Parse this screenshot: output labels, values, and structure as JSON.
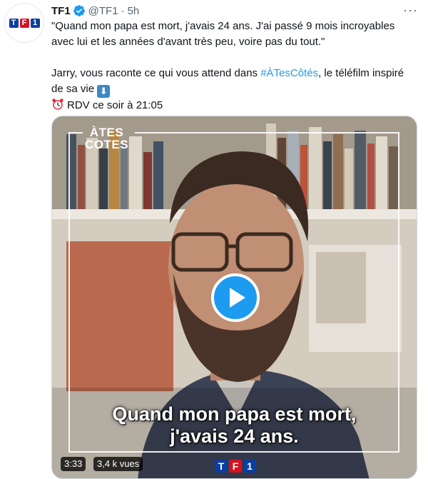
{
  "tweet": {
    "author_name": "TF1",
    "handle": "@TF1",
    "separator": "·",
    "time": "5h",
    "more_label": "···",
    "avatar_logo": [
      "T",
      "F",
      "1"
    ],
    "line1": "\"Quand mon papa est mort, j'avais 24 ans. J'ai passé 9 mois incroyables",
    "line2": "avec lui et les années d'avant très peu, voire pas du tout.\"",
    "line3_pre": "Jarry, vous raconte ce qui vous attend dans ",
    "hashtag": "#ÀTesCôtés",
    "line3_post": ", le téléfilm inspiré",
    "line4": "de sa vie ",
    "down_arrow": "⬇",
    "line5": "RDV ce soir à 21:05"
  },
  "media": {
    "show_logo_line1": "ÀTES",
    "show_logo_line2": "COTES",
    "subtitle_line1": "Quand mon papa est mort,",
    "subtitle_line2": "j'avais 24 ans.",
    "duration": "3:33",
    "views": "3,4 k vues",
    "watermark": [
      "T",
      "F",
      "1"
    ]
  },
  "colors": {
    "link": "#1d9bf0",
    "secondary_text": "#536471",
    "verified": "#1d9bf0",
    "tf1_blue": "#0a3ea0",
    "tf1_red": "#d5121e"
  },
  "icons": {
    "verified": "verified-badge-icon",
    "alarm": "alarm-clock-icon",
    "down": "down-arrow-icon",
    "play": "play-icon",
    "more": "more-options-icon"
  }
}
